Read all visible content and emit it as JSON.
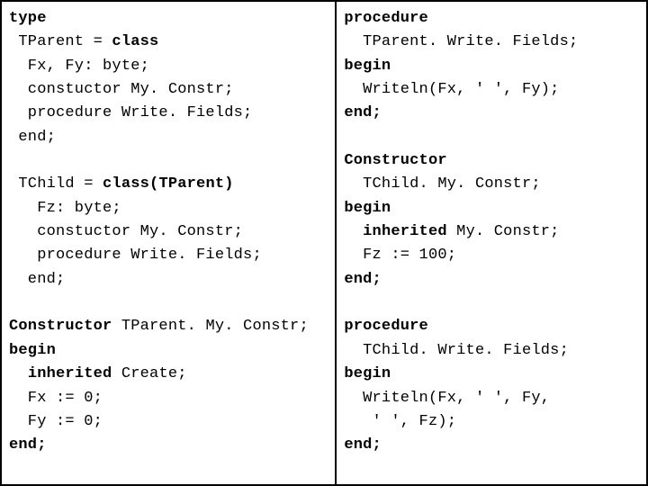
{
  "kw": {
    "type": "type",
    "class": "class",
    "classParent": "class(TParent)",
    "procedure": "procedure",
    "Constructor": "Constructor",
    "begin": "begin",
    "end": "end;",
    "inherited": "inherited"
  },
  "left": {
    "l1b": " TParent = ",
    "l2": "  Fx, Fy: byte;",
    "l3": "  constuctor My. Constr;",
    "l4": "  procedure Write. Fields;",
    "l5": " end;",
    "l6a": " TChild = ",
    "l7": "   Fz: byte;",
    "l8": "   constuctor My. Constr;",
    "l9": "   procedure Write. Fields;",
    "l10": "  end;",
    "l11b": " TParent. My. Constr;",
    "l13b": " Create;",
    "l14": "  Fx := 0;",
    "l15": "  Fy := 0;"
  },
  "right": {
    "r1": "  TParent. Write. Fields;",
    "r3": "  Writeln(Fx, ' ', Fy);",
    "r6": "  TChild. My. Constr;",
    "r8b": " My. Constr;",
    "r9": "  Fz := 100;",
    "r12": "  TChild. Write. Fields;",
    "r14": "  Writeln(Fx, ' ', Fy,",
    "r15": "   ' ', Fz);"
  }
}
